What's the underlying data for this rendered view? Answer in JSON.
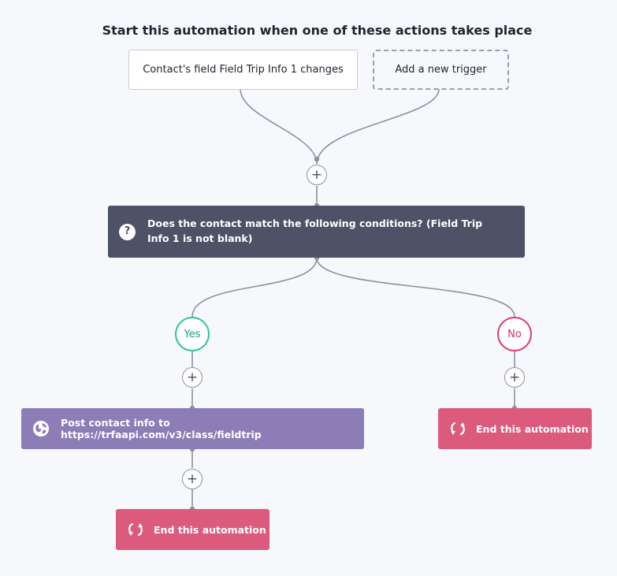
{
  "header": {
    "title": "Start this automation when one of these actions takes place"
  },
  "triggers": {
    "existing_label": "Contact's field Field Trip Info 1 changes",
    "add_label": "Add a new trigger"
  },
  "plus_symbol": "+",
  "condition": {
    "icon_glyph": "?",
    "label": "Does the contact match the following conditions? (Field Trip Info 1 is not blank)"
  },
  "branches": {
    "yes_label": "Yes",
    "no_label": "No"
  },
  "actions": {
    "webhook_label": "Post contact info to https://trfaapi.com/v3/class/fieldtrip",
    "end_label": "End this automation"
  },
  "colors": {
    "condition_bg": "#4e5266",
    "webhook_bg": "#8c7db7",
    "end_bg": "#dc5b7c",
    "yes_border": "#2fc29a",
    "no_border": "#e0396a",
    "connector": "#8d91a0"
  }
}
